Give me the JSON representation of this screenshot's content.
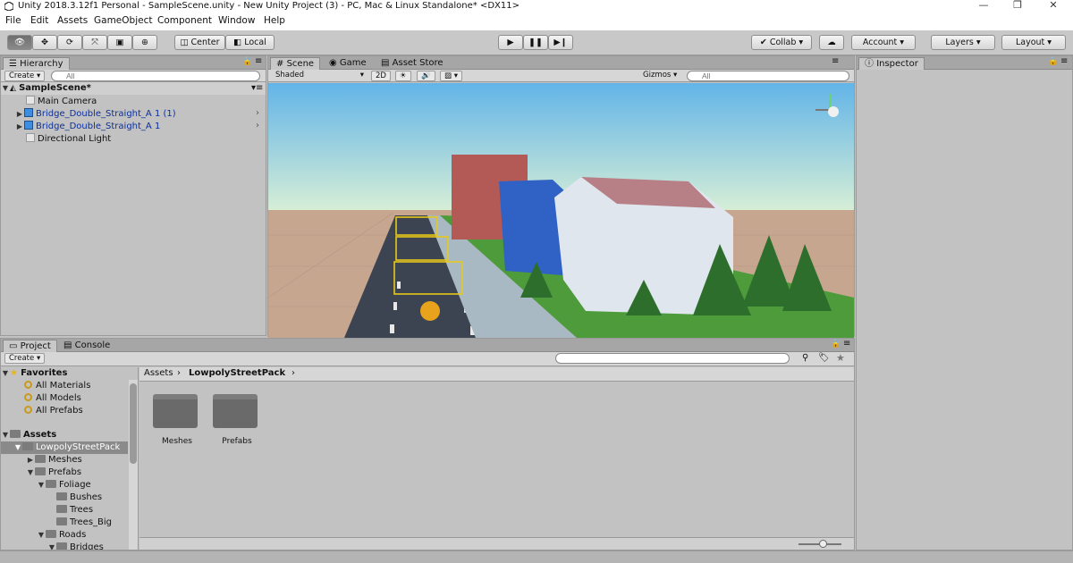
{
  "window": {
    "title": "Unity 2018.3.12f1 Personal - SampleScene.unity - New Unity Project (3) - PC, Mac & Linux Standalone* <DX11>",
    "minimize": "—",
    "restore": "❐",
    "close": "✕"
  },
  "menu": [
    "File",
    "Edit",
    "Assets",
    "GameObject",
    "Component",
    "Window",
    "Help"
  ],
  "toolbar": {
    "pivot_center": "Center",
    "pivot_local": "Local",
    "collab": "Collab ▾",
    "account": "Account",
    "layers": "Layers",
    "layout": "Layout"
  },
  "hierarchy": {
    "tab": "Hierarchy",
    "create": "Create",
    "search_placeholder": "All",
    "scene": "SampleScene*",
    "items": [
      {
        "label": "Main Camera",
        "type": "grey"
      },
      {
        "label": "Bridge_Double_Straight_A 1 (1)",
        "type": "prefab"
      },
      {
        "label": "Bridge_Double_Straight_A 1",
        "type": "prefab"
      },
      {
        "label": "Directional Light",
        "type": "grey"
      }
    ]
  },
  "scene": {
    "tabs": [
      "Scene",
      "Game",
      "Asset Store"
    ],
    "shading": "Shaded",
    "mode_2d": "2D",
    "gizmos": "Gizmos",
    "search_placeholder": "All",
    "colors": {
      "sky_top": "#62b4e8",
      "sky_bottom": "#d8efd6",
      "ground": "#c7a690",
      "road": "#3c4452",
      "grass": "#4d9b3a"
    }
  },
  "inspector": {
    "tab": "Inspector"
  },
  "project": {
    "tabs": [
      "Project",
      "Console"
    ],
    "create": "Create",
    "favorites": {
      "label": "Favorites",
      "items": [
        "All Materials",
        "All Models",
        "All Prefabs"
      ]
    },
    "assets_label": "Assets",
    "tree": [
      {
        "label": "LowpolyStreetPack",
        "depth": 1,
        "selected": true
      },
      {
        "label": "Meshes",
        "depth": 2
      },
      {
        "label": "Prefabs",
        "depth": 2
      },
      {
        "label": "Foliage",
        "depth": 3
      },
      {
        "label": "Bushes",
        "depth": 4
      },
      {
        "label": "Trees",
        "depth": 4
      },
      {
        "label": "Trees_Big",
        "depth": 4
      },
      {
        "label": "Roads",
        "depth": 3
      },
      {
        "label": "Bridges",
        "depth": 4
      }
    ],
    "breadcrumb": {
      "root": "Assets",
      "current": "LowpolyStreetPack"
    },
    "folders": [
      "Meshes",
      "Prefabs"
    ]
  }
}
